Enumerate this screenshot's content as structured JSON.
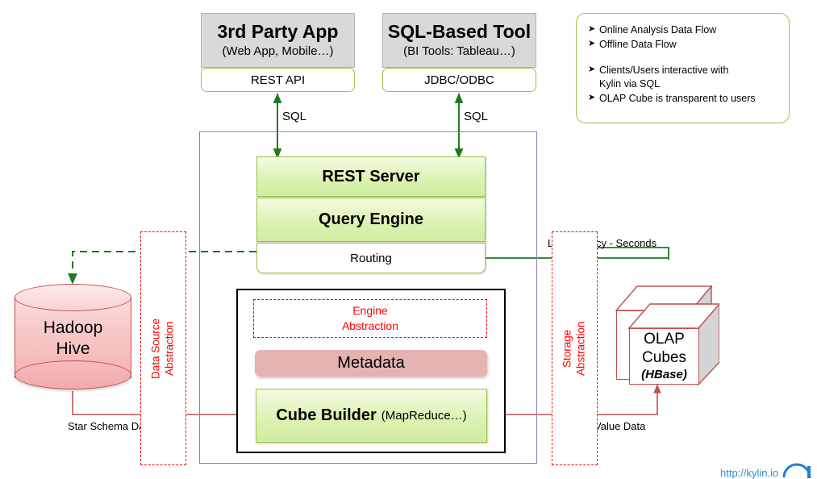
{
  "clients": [
    {
      "title": "3rd Party App",
      "subtitle": "(Web App, Mobile…)",
      "api": "REST API",
      "protocol": "SQL"
    },
    {
      "title": "SQL-Based Tool",
      "subtitle": "(BI Tools: Tableau…)",
      "api": "JDBC/ODBC",
      "protocol": "SQL"
    }
  ],
  "legend": {
    "bullet": "➤",
    "items": [
      "Online  Analysis  Data Flow",
      "Offline  Data Flow",
      "Clients/Users  interactive with",
      "Kylin via SQL",
      "OLAP Cube  is transparent to users"
    ],
    "arrow_online_color": "#1f7a1f",
    "arrow_offline_color": "#cc6666"
  },
  "core": {
    "rest_server": "REST Server",
    "query_engine": "Query Engine",
    "routing": "Routing",
    "engine_abstraction_line1": "Engine",
    "engine_abstraction_line2": "Abstraction",
    "metadata": "Metadata",
    "cube_builder": "Cube Builder",
    "cube_builder_note": "(MapReduce…)"
  },
  "abstractions": {
    "data_source": "Data Source\nAbstraction",
    "storage": "Storage\nAbstraction"
  },
  "datasource": {
    "name_line1": "Hadoop",
    "name_line2": "Hive",
    "flow_label": "Star Schema  Data"
  },
  "storage": {
    "name_line1": "OLAP",
    "name_line2": "Cubes",
    "name_line3": "(HBase)",
    "latency_label": "Low Latency - Seconds",
    "flow_label": "Key Value Data"
  },
  "watermark": "http://kylin.io",
  "colors": {
    "green_box_border": "#9ac24a",
    "red_dashed": "#ff0000",
    "purple_border": "#8f7ec8",
    "metadata_fill": "#e6b3b3",
    "hive_fill": "#f5b3b3",
    "online_flow": "#1f7a1f",
    "offline_flow": "#c0504d"
  }
}
